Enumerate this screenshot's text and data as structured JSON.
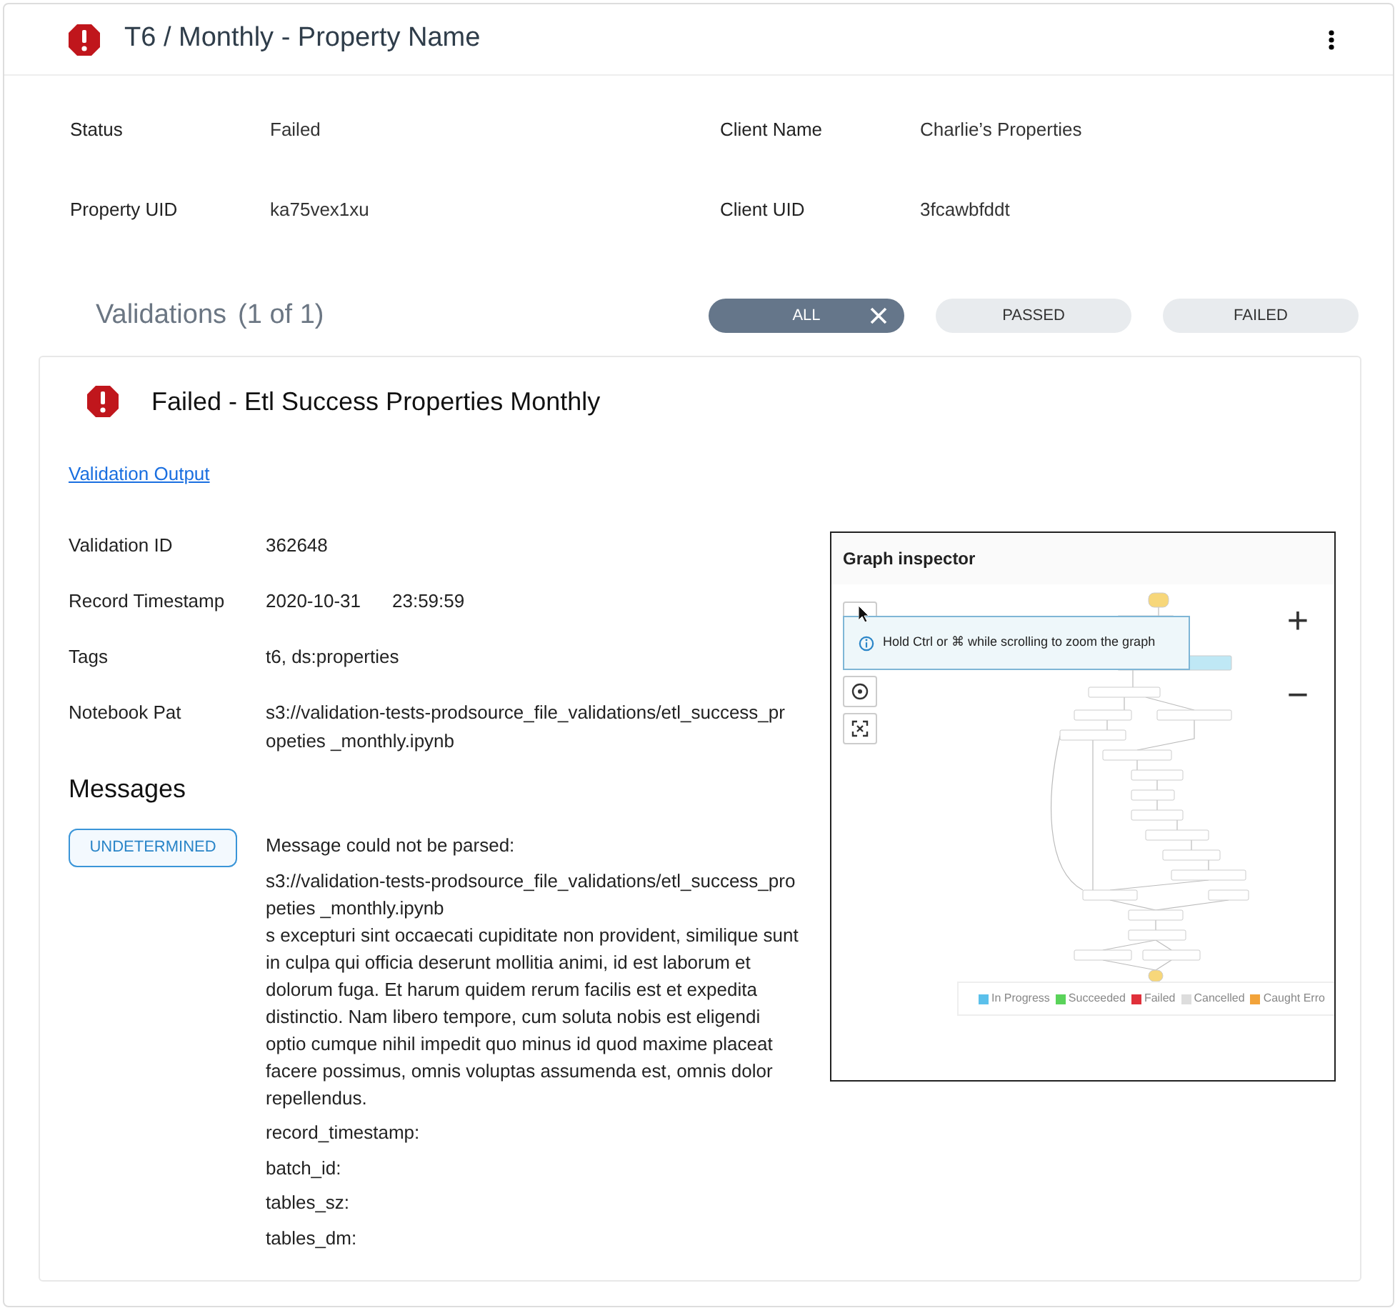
{
  "header": {
    "title": "T6 / Monthly - Property Name"
  },
  "details": [
    {
      "label": "Status",
      "value": "Failed"
    },
    {
      "label": "Client Name",
      "value": "Charlie’s Properties"
    },
    {
      "label": "Property UID",
      "value": "ka75vex1xu"
    },
    {
      "label": "Client UID",
      "value": "3fcawbfddt"
    }
  ],
  "validations": {
    "title": "Validations",
    "count": "(1 of 1)"
  },
  "filters": [
    {
      "label": "ALL",
      "selected": true
    },
    {
      "label": "PASSED",
      "selected": false
    },
    {
      "label": "FAILED",
      "selected": false
    }
  ],
  "result": {
    "title": "Failed - Etl Success Properties Monthly",
    "link": "Validation Output",
    "fields": [
      {
        "label": "Validation ID",
        "values": [
          "362648"
        ]
      },
      {
        "label": "Record Timestamp",
        "values": [
          "2020-10-31",
          "23:59:59"
        ]
      },
      {
        "label": "Tags",
        "values": [
          "t6, ds:properties"
        ]
      },
      {
        "label": "Notebook Pat",
        "values": [
          "s3://validation-tests-prodsource_file_validations/etl_success_propeties _monthly.ipynb"
        ]
      }
    ],
    "messages_heading": "Messages",
    "badge": "UNDETERMINED",
    "message_title": "Message could not be parsed:",
    "message_path": "s3://validation-tests-prodsource_file_validations/etl_success_propeties _monthly.ipynb",
    "message_body": "s excepturi sint occaecati cupiditate non provident, similique sunt in culpa qui officia deserunt mollitia animi, id est laborum et dolorum fuga. Et harum quidem rerum facilis est et expedita distinctio. Nam libero tempore, cum soluta nobis est eligendi optio cumque nihil impedit quo minus id quod maxime placeat facere possimus, omnis voluptas assumenda est, omnis dolor repellendus.",
    "extra_fields": [
      "record_timestamp:",
      "batch_id:",
      "tables_sz:",
      "tables_dm:"
    ]
  },
  "graph_inspector": {
    "title": "Graph inspector",
    "hint": "Hold Ctrl or ⌘ while scrolling to zoom the graph",
    "zoom_in": "+",
    "zoom_out": "−",
    "legend": [
      {
        "label": "In Progress",
        "color": "#5bc0eb"
      },
      {
        "label": "Succeeded",
        "color": "#5ad35a"
      },
      {
        "label": "Failed",
        "color": "#e0303a"
      },
      {
        "label": "Cancelled",
        "color": "#dddddd"
      },
      {
        "label": "Caught Erro",
        "color": "#f2a33a"
      }
    ]
  }
}
